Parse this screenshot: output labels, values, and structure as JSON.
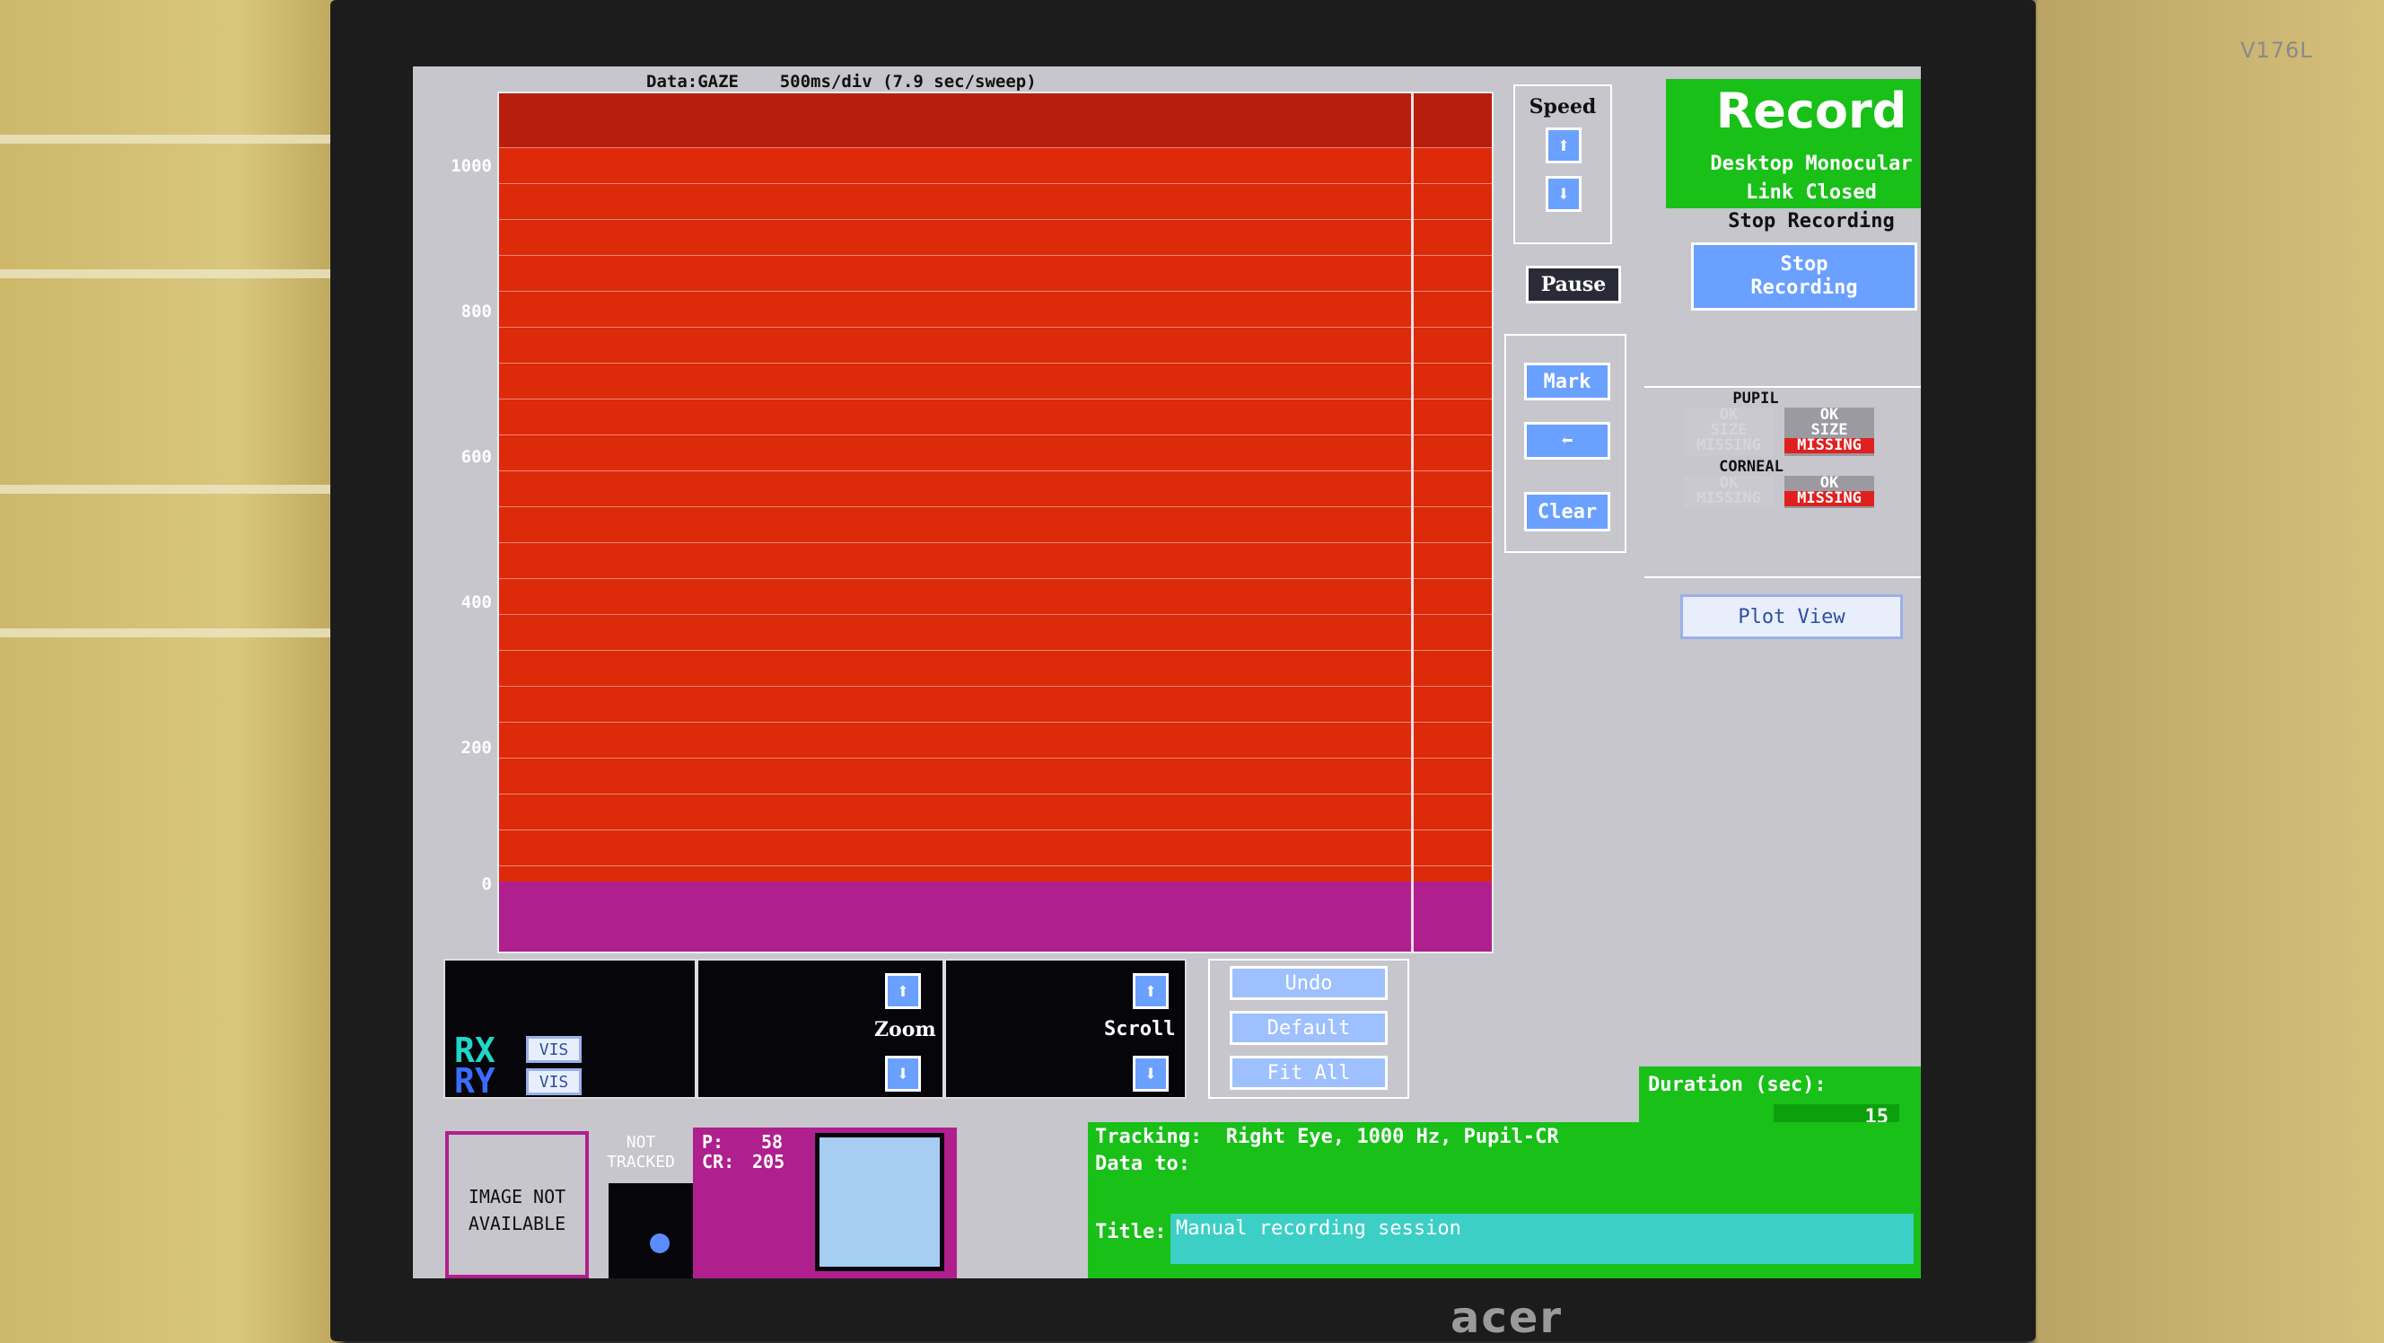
{
  "monitor": {
    "model": "V176L",
    "brand": "acer"
  },
  "plot": {
    "header": "Data:GAZE    500ms/div (7.9 sec/sweep)",
    "y_ticks": [
      "1000",
      "800",
      "600",
      "400",
      "200",
      "0"
    ]
  },
  "speed_panel": {
    "label": "Speed",
    "pause": "Pause"
  },
  "mark_panel": {
    "mark": "Mark",
    "clear": "Clear"
  },
  "record_panel": {
    "title": "Record",
    "mode": "Desktop Monocular",
    "link": "Link Closed",
    "stop_heading": "Stop Recording",
    "stop_button": "Stop\nRecording",
    "pupil_label": "PUPIL",
    "pupil_left": [
      "OK",
      "SIZE",
      "MISSING"
    ],
    "pupil_right": [
      "OK",
      "SIZE",
      "MISSING"
    ],
    "corneal_label": "CORNEAL",
    "corneal_left": [
      "OK",
      "MISSING"
    ],
    "corneal_right": [
      "OK",
      "MISSING"
    ],
    "plot_view": "Plot View",
    "duration_label": "Duration (sec):",
    "duration_value": "15"
  },
  "traces": {
    "rx": "RX",
    "ry": "RY",
    "vis": "VIS"
  },
  "controls": {
    "zoom": "Zoom",
    "scroll": "Scroll",
    "undo": "Undo",
    "default": "Default",
    "fit_all": "Fit All"
  },
  "camera": {
    "image_not_available": "IMAGE NOT\nAVAILABLE",
    "not_tracked": "NOT\nTRACKED",
    "p_label": "P:",
    "p_value": "58",
    "cr_label": "CR:",
    "cr_value": "205"
  },
  "status": {
    "tracking": "Tracking:  Right Eye, 1000 Hz, Pupil-CR",
    "data_to": "Data to:",
    "title_label": "Title:",
    "title_value": "Manual recording session"
  },
  "colors": {
    "plot_red": "#dd2a0a",
    "plot_magenta": "#b01f8e",
    "green_panel": "#18c018",
    "button_blue": "#6aa0ff",
    "missing_red": "#e02020"
  }
}
